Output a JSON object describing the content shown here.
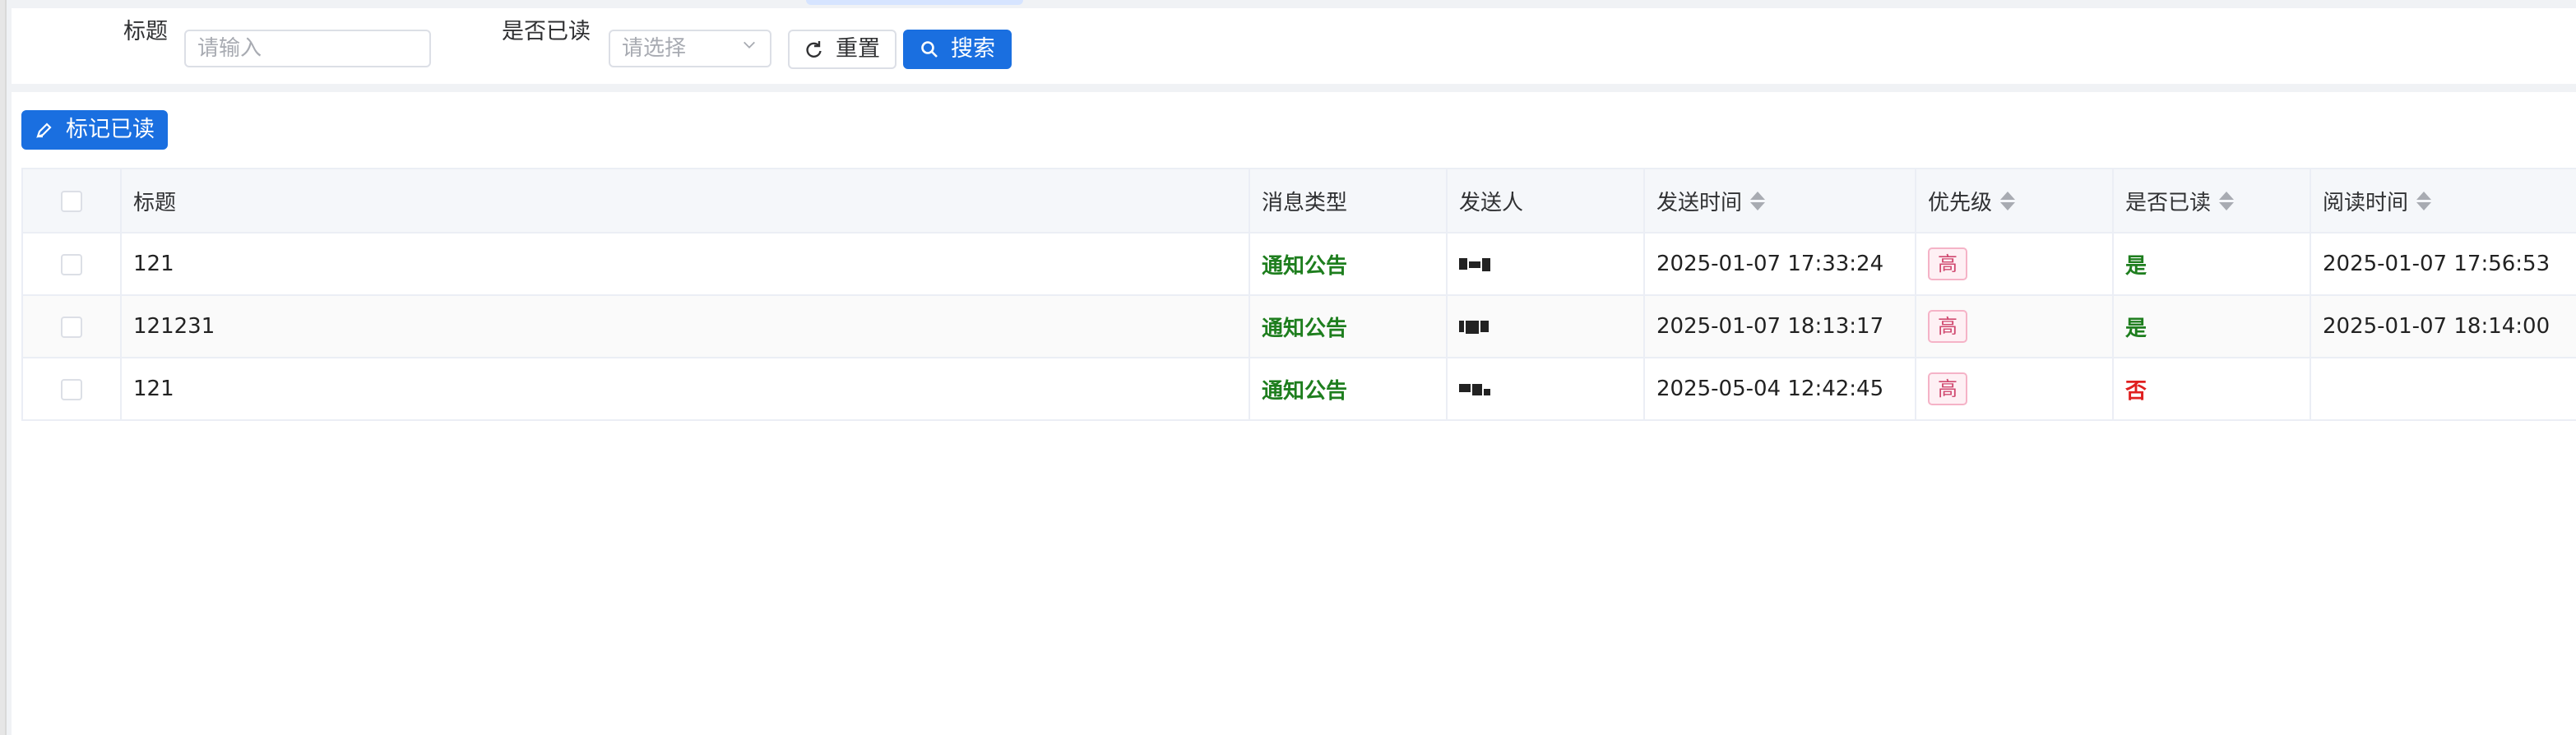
{
  "search": {
    "title_label": "标题",
    "title_placeholder": "请输入",
    "read_label": "是否已读",
    "read_placeholder": "请选择",
    "reset_label": "重置",
    "search_label": "搜索"
  },
  "toolbar": {
    "mark_read_label": "标记已读"
  },
  "table": {
    "columns": {
      "title": "标题",
      "type": "消息类型",
      "sender": "发送人",
      "send_time": "发送时间",
      "priority": "优先级",
      "is_read": "是否已读",
      "read_time": "阅读时间"
    },
    "rows": [
      {
        "title": "121",
        "type": "通知公告",
        "send_time": "2025-01-07 17:33:24",
        "priority": "高",
        "is_read": "是",
        "read_time": "2025-01-07 17:56:53"
      },
      {
        "title": "121231",
        "type": "通知公告",
        "send_time": "2025-01-07 18:13:17",
        "priority": "高",
        "is_read": "是",
        "read_time": "2025-01-07 18:14:00"
      },
      {
        "title": "121",
        "type": "通知公告",
        "send_time": "2025-05-04 12:42:45",
        "priority": "高",
        "is_read": "否",
        "read_time": ""
      }
    ]
  },
  "colors": {
    "primary": "#1a6fe0",
    "type_green": "#1e7e1e",
    "read_no_red": "#e02020",
    "priority_pink": "#d0486f"
  },
  "icons": [
    "refresh-icon",
    "search-icon",
    "edit-icon",
    "chevron-down-icon",
    "sort-icon"
  ]
}
